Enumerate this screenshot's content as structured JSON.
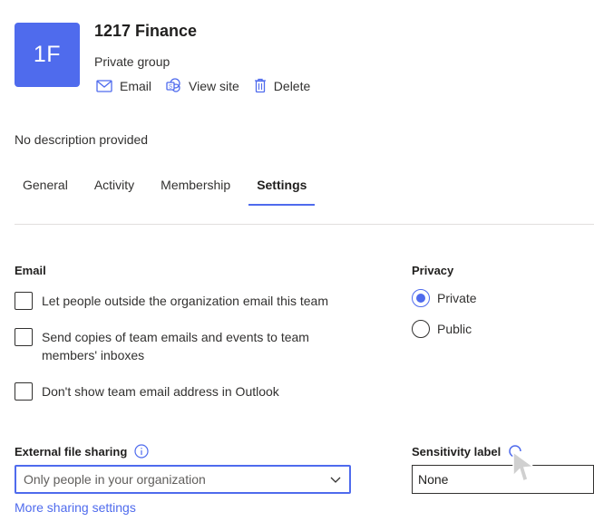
{
  "header": {
    "avatar_initials": "1F",
    "title": "1217 Finance",
    "subtitle": "Private group",
    "actions": [
      {
        "label": "Email",
        "icon": "mail-icon"
      },
      {
        "label": "View site",
        "icon": "sharepoint-site-icon"
      },
      {
        "label": "Delete",
        "icon": "trash-icon"
      }
    ]
  },
  "description": "No description provided",
  "tabs": [
    {
      "label": "General",
      "active": false
    },
    {
      "label": "Activity",
      "active": false
    },
    {
      "label": "Membership",
      "active": false
    },
    {
      "label": "Settings",
      "active": true
    }
  ],
  "email_section": {
    "title": "Email",
    "options": [
      {
        "label": "Let people outside the organization email this team",
        "checked": false
      },
      {
        "label": "Send copies of team emails and events to team members' inboxes",
        "checked": false
      },
      {
        "label": "Don't show team email address in Outlook",
        "checked": false
      }
    ]
  },
  "privacy_section": {
    "title": "Privacy",
    "options": [
      {
        "label": "Private",
        "checked": true
      },
      {
        "label": "Public",
        "checked": false
      }
    ]
  },
  "external_sharing": {
    "title": "External file sharing",
    "info_icon": "info-icon",
    "selected": "Only people in your organization",
    "link": "More sharing settings"
  },
  "sensitivity": {
    "title": "Sensitivity label",
    "selected": "None"
  },
  "colors": {
    "accent": "#4f6bed",
    "text": "#323130"
  }
}
